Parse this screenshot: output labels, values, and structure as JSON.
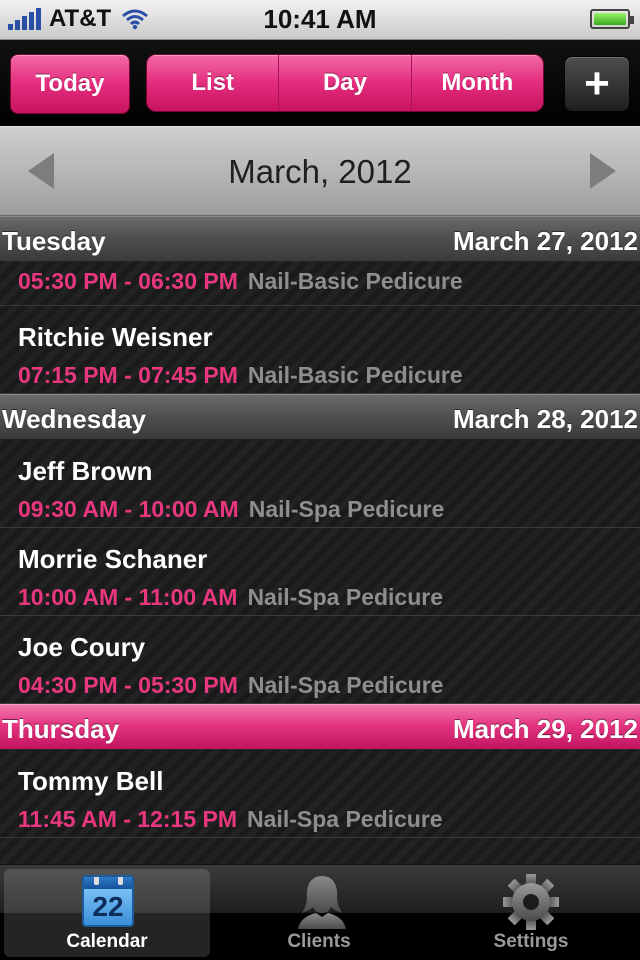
{
  "status_bar": {
    "carrier": "AT&T",
    "time": "10:41 AM",
    "battery_level": 1.0
  },
  "toolbar": {
    "today_label": "Today",
    "view_options": [
      "List",
      "Day",
      "Month"
    ],
    "selected_view": "List",
    "add_label": "+"
  },
  "calendar": {
    "month_title": "March, 2012"
  },
  "days": [
    {
      "day": "Tuesday",
      "date": "March 27, 2012",
      "appointments": [
        {
          "client": "",
          "time": "05:30 PM - 06:30 PM",
          "service": "Nail-Basic Pedicure"
        },
        {
          "client": "Ritchie Weisner",
          "time": "07:15 PM - 07:45 PM",
          "service": "Nail-Basic Pedicure"
        }
      ]
    },
    {
      "day": "Wednesday",
      "date": "March 28, 2012",
      "appointments": [
        {
          "client": "Jeff Brown",
          "time": "09:30 AM - 10:00 AM",
          "service": "Nail-Spa Pedicure"
        },
        {
          "client": "Morrie Schaner",
          "time": "10:00 AM - 11:00 AM",
          "service": "Nail-Spa Pedicure"
        },
        {
          "client": "Joe Coury",
          "time": "04:30 PM - 05:30 PM",
          "service": "Nail-Spa Pedicure"
        }
      ]
    },
    {
      "day": "Thursday",
      "date": "March 29, 2012",
      "appointments": [
        {
          "client": "Tommy Bell",
          "time": "11:45 AM - 12:15 PM",
          "service": "Nail-Spa Pedicure"
        }
      ]
    }
  ],
  "tabbar": {
    "tabs": [
      {
        "label": "Calendar",
        "icon": "calendar-icon",
        "icon_text": "22"
      },
      {
        "label": "Clients",
        "icon": "client-silhouette-icon"
      },
      {
        "label": "Settings",
        "icon": "gear-icon"
      }
    ],
    "active_tab": "Calendar"
  },
  "colors": {
    "accent_pink": "#e3347f",
    "time_text": "#e8377f",
    "service_text": "#8e8e8e"
  }
}
